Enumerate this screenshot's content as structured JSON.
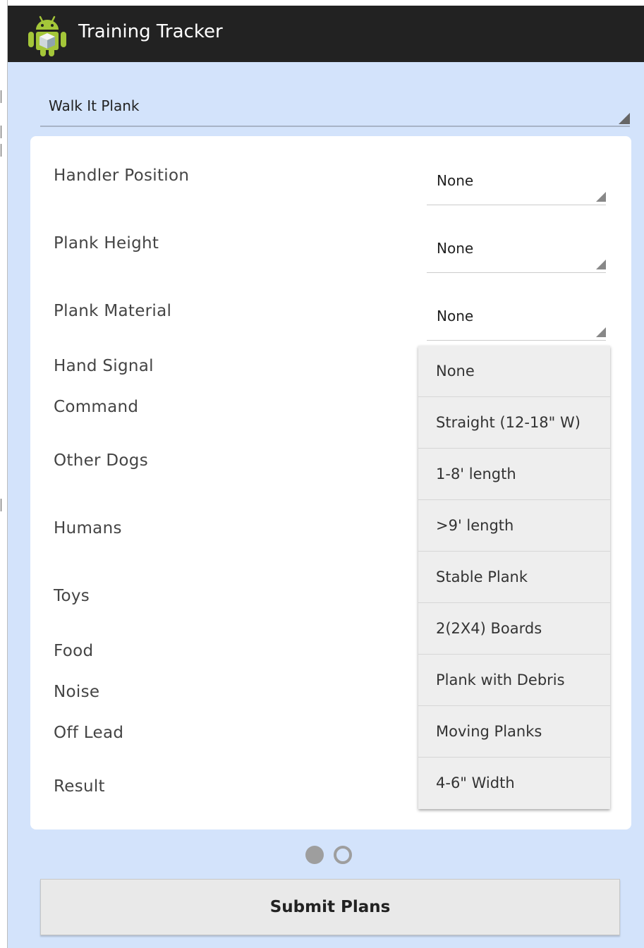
{
  "app": {
    "title": "Training Tracker",
    "icon": "android-robot-icon"
  },
  "plan_spinner": {
    "value": "Walk It Plank"
  },
  "form": {
    "rows": [
      {
        "label": "Handler Position",
        "value": "None"
      },
      {
        "label": "Plank Height",
        "value": "None"
      },
      {
        "label": "Plank Material",
        "value": "None"
      },
      {
        "label": "Hand Signal"
      },
      {
        "label": "Command"
      },
      {
        "label": "Other Dogs"
      },
      {
        "label": "Humans"
      },
      {
        "label": "Toys"
      },
      {
        "label": "Food"
      },
      {
        "label": "Noise"
      },
      {
        "label": "Off Lead"
      },
      {
        "label": "Result"
      }
    ]
  },
  "dropdown": {
    "options": [
      "None",
      "Straight (12-18\" W)",
      "1-8' length",
      ">9' length",
      "Stable Plank",
      "2(2X4) Boards",
      "Plank with Debris",
      "Moving Planks",
      "4-6\" Width"
    ]
  },
  "pager": {
    "current_page": 1,
    "total_pages": 2
  },
  "submit": {
    "label": "Submit Plans"
  },
  "colors": {
    "action_bar": "#222222",
    "background": "#d3e3fb",
    "card": "#ffffff",
    "dropdown": "#eeeeee",
    "android_green": "#a4c639"
  }
}
